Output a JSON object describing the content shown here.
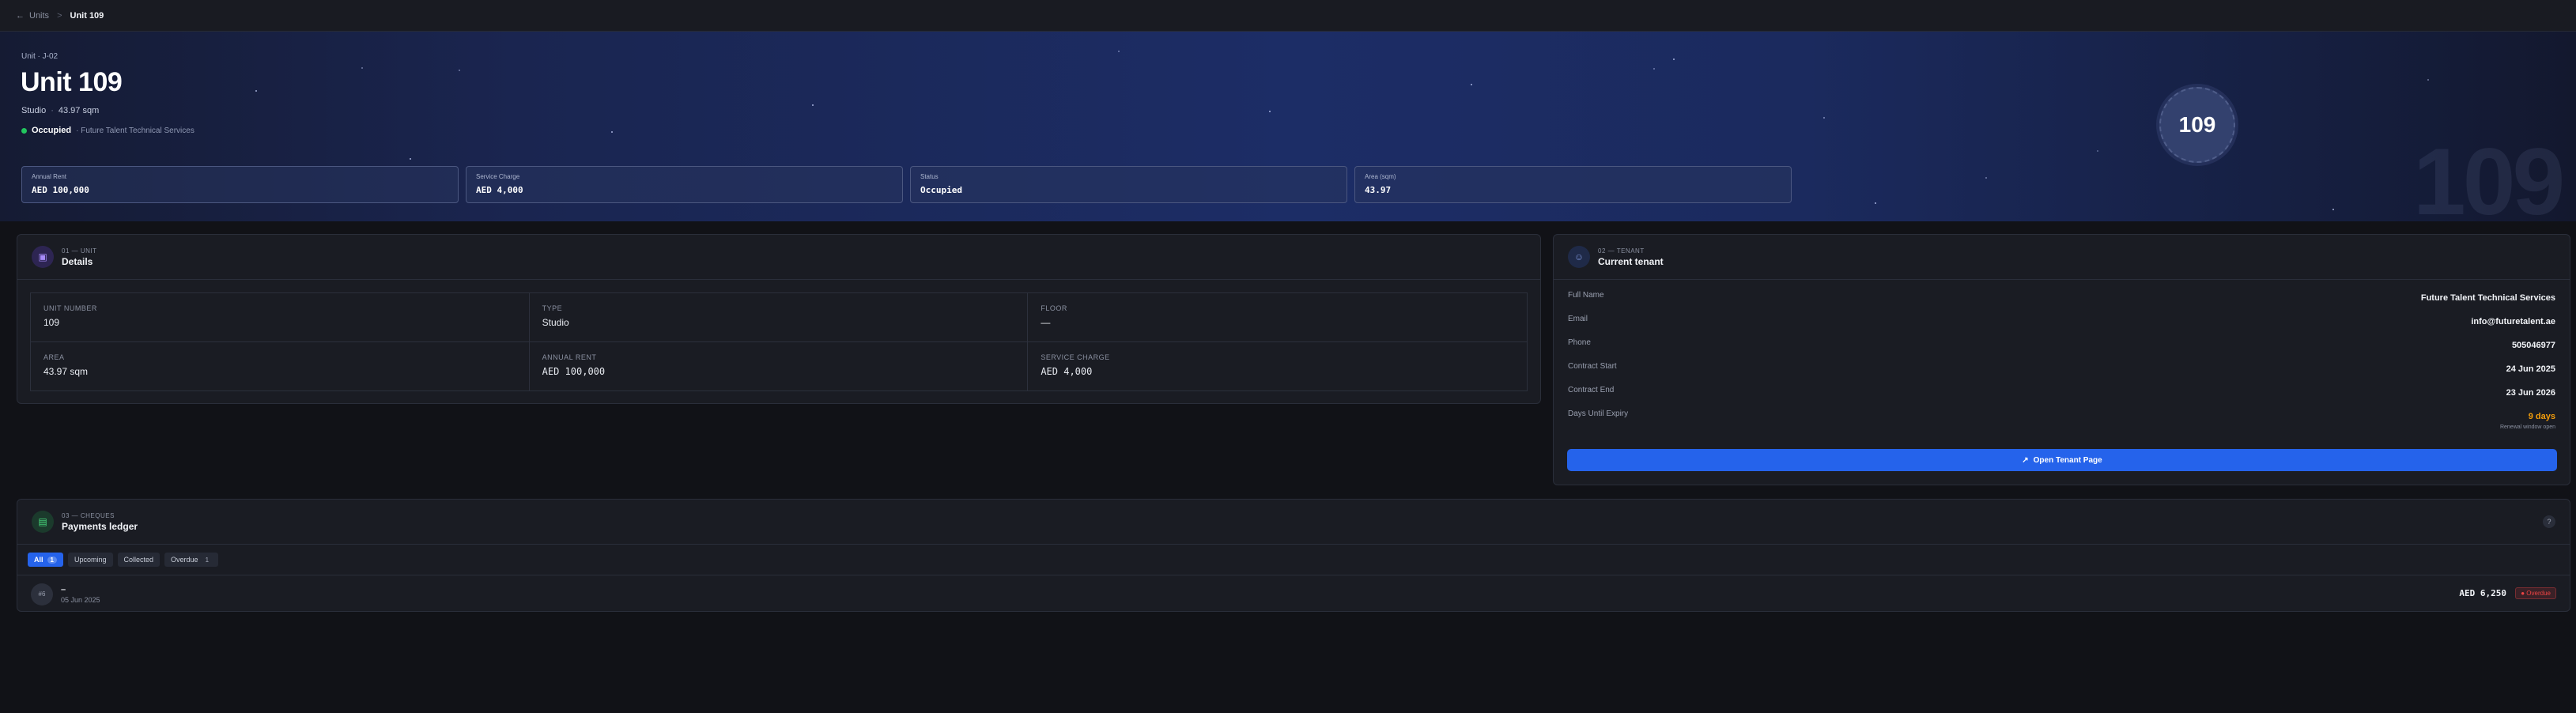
{
  "topbar": {
    "back_label": "Units",
    "separator": ">",
    "current": "Unit 109"
  },
  "hero": {
    "crumb": "Unit · J-02",
    "title": "Unit 109",
    "type": "Studio",
    "area": "43.97 sqm",
    "status": "Occupied",
    "tenant": "· Future Talent Technical Services",
    "badge_number": "109",
    "watermark": "109",
    "stats": [
      {
        "label": "Annual Rent",
        "value": "AED 100,000"
      },
      {
        "label": "Service Charge",
        "value": "AED 4,000"
      },
      {
        "label": "Status",
        "value": "Occupied"
      },
      {
        "label": "Area (sqm)",
        "value": "43.97"
      }
    ]
  },
  "details": {
    "kicker": "01 — UNIT",
    "title": "Details",
    "cells": [
      {
        "label": "UNIT NUMBER",
        "value": "109"
      },
      {
        "label": "TYPE",
        "value": "Studio"
      },
      {
        "label": "FLOOR",
        "value": "—"
      },
      {
        "label": "AREA",
        "value": "43.97 sqm"
      },
      {
        "label": "ANNUAL RENT",
        "value": "AED 100,000"
      },
      {
        "label": "SERVICE CHARGE",
        "value": "AED 4,000"
      }
    ]
  },
  "tenant": {
    "kicker": "02 — TENANT",
    "title": "Current tenant",
    "rows": [
      {
        "label": "Full Name",
        "value": "Future Talent Technical Services"
      },
      {
        "label": "Email",
        "value": "info@futuretalent.ae"
      },
      {
        "label": "Phone",
        "value": "505046977"
      },
      {
        "label": "Contract Start",
        "value": "24 Jun 2025"
      },
      {
        "label": "Contract End",
        "value": "23 Jun 2026"
      },
      {
        "label": "Days Until Expiry",
        "value": "9 days",
        "hint": "Renewal window open"
      }
    ],
    "button_label": "Open Tenant Page"
  },
  "ledger": {
    "kicker": "03 — CHEQUES",
    "title": "Payments ledger",
    "help": "?",
    "filters": [
      {
        "label": "All",
        "count": "1"
      },
      {
        "label": "Upcoming",
        "count": ""
      },
      {
        "label": "Collected",
        "count": ""
      },
      {
        "label": "Overdue",
        "count": "1"
      }
    ],
    "payments": [
      {
        "avatar": "#6",
        "ref": "–",
        "date": "05 Jun 2025",
        "amount": "AED 6,250",
        "status": "● Overdue"
      }
    ]
  },
  "colors": {
    "accent": "#2563eb",
    "success": "#22c55e",
    "warning": "#f59e0b",
    "danger": "#ef4444"
  }
}
